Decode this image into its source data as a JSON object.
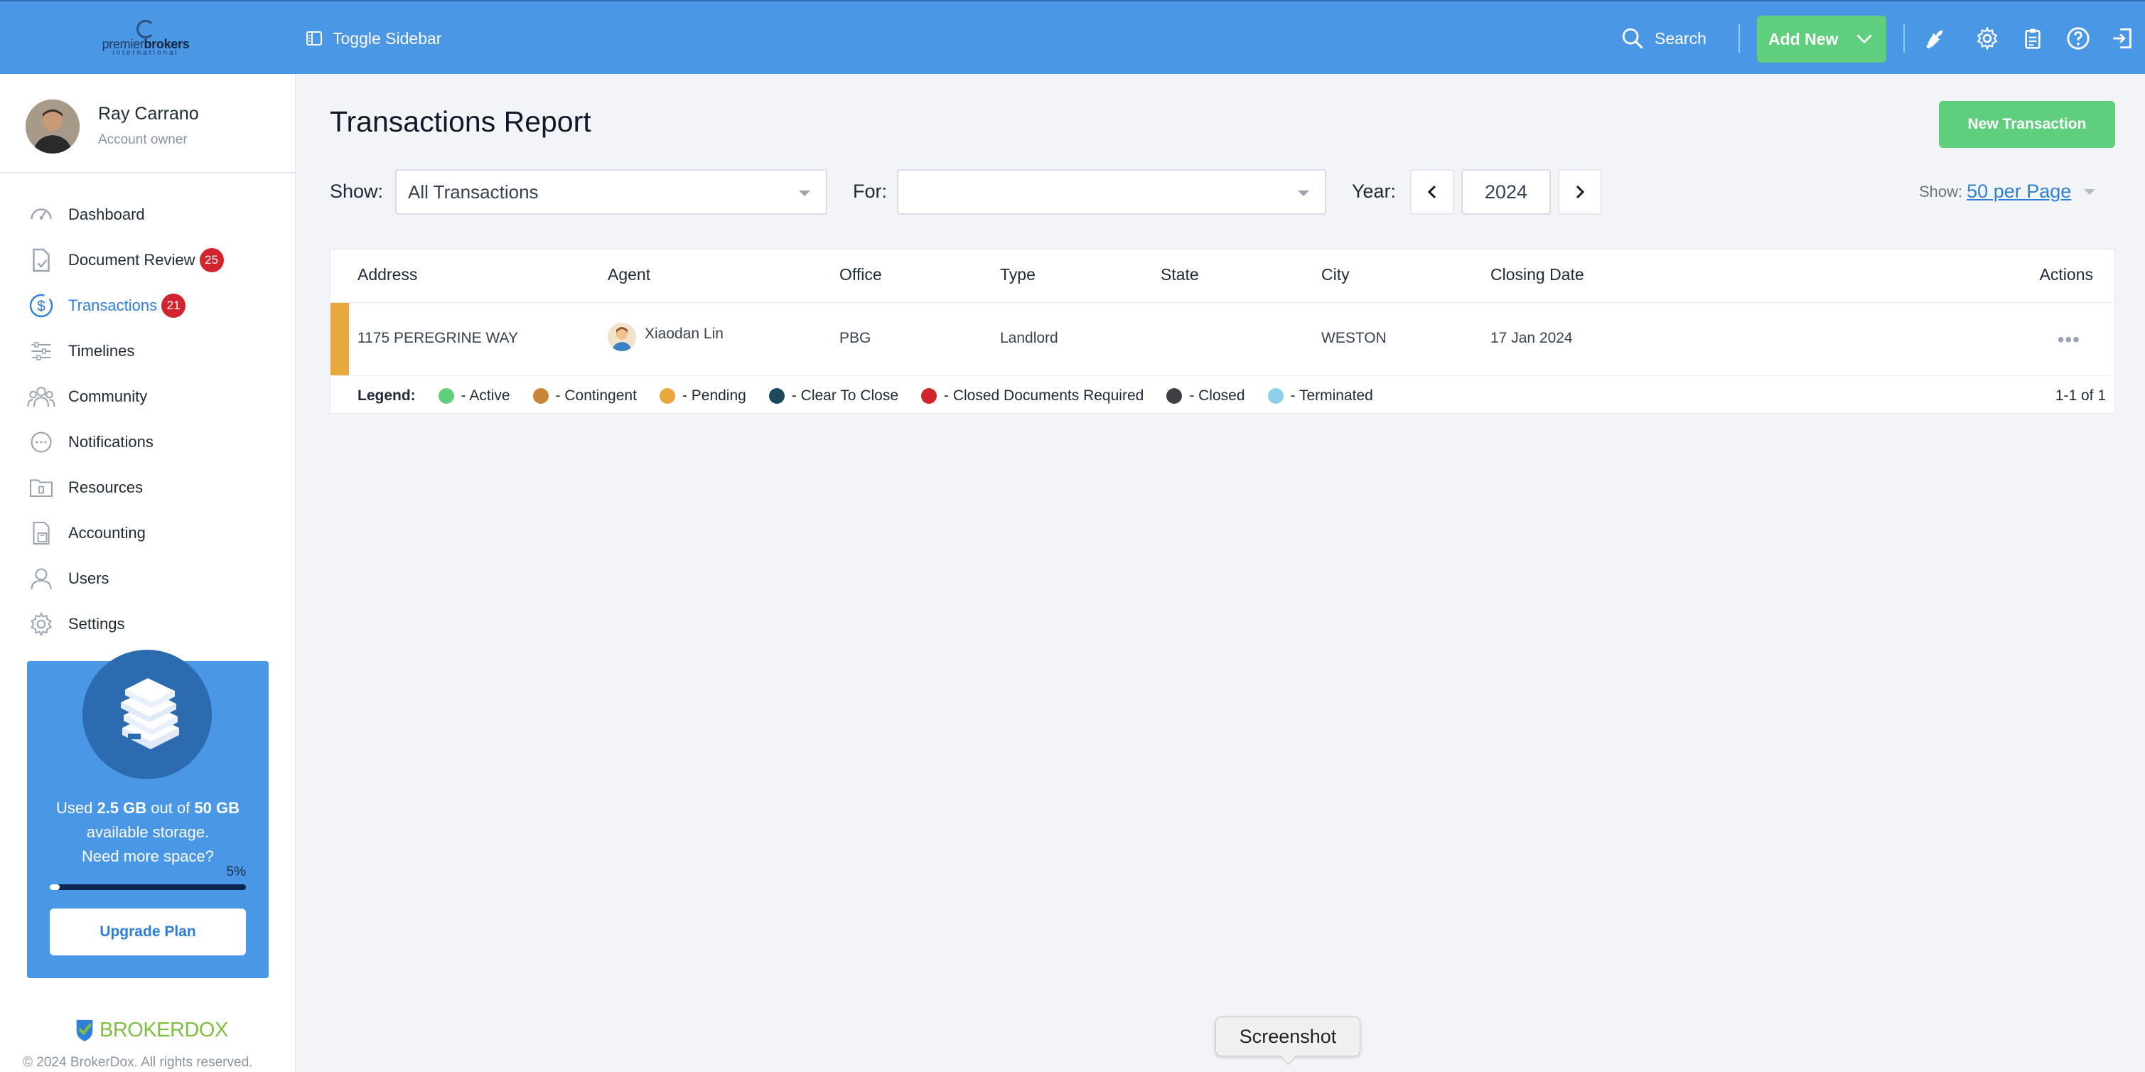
{
  "topbar": {
    "logo": {
      "text_light": "premier",
      "text_bold": "brokers",
      "sub": "international"
    },
    "toggle_label": "Toggle Sidebar",
    "search_label": "Search",
    "add_new_label": "Add New",
    "icons": [
      "bell-icon",
      "gear-icon",
      "clipboard-icon",
      "help-icon",
      "logout-icon"
    ]
  },
  "user": {
    "name": "Ray Carrano",
    "role": "Account owner"
  },
  "nav": [
    {
      "label": "Dashboard",
      "icon": "gauge-icon"
    },
    {
      "label": "Document Review",
      "icon": "document-check-icon",
      "badge": "25"
    },
    {
      "label": "Transactions",
      "icon": "dollar-circle-icon",
      "badge": "21",
      "active": true
    },
    {
      "label": "Timelines",
      "icon": "sliders-icon"
    },
    {
      "label": "Community",
      "icon": "people-icon"
    },
    {
      "label": "Notifications",
      "icon": "chat-bubble-icon"
    },
    {
      "label": "Resources",
      "icon": "folder-icon"
    },
    {
      "label": "Accounting",
      "icon": "calculator-icon"
    },
    {
      "label": "Users",
      "icon": "user-icon"
    },
    {
      "label": "Settings",
      "icon": "gear-icon"
    }
  ],
  "storage": {
    "used": "2.5 GB",
    "total": "50 GB",
    "line1_prefix": "Used ",
    "line1_mid": " out of ",
    "line2": "available storage.",
    "line3": "Need more space?",
    "percent_label": "5%",
    "percent": 5,
    "upgrade_label": "Upgrade Plan"
  },
  "footer": {
    "brand_a": "BROKER",
    "brand_b": "DOX",
    "copyright": "© 2024 BrokerDox. All rights reserved."
  },
  "main": {
    "title": "Transactions Report",
    "new_button": "New Transaction",
    "filters": {
      "show_label": "Show:",
      "show_value": "All Transactions",
      "for_label": "For:",
      "for_value": "",
      "year_label": "Year:",
      "year_value": "2024",
      "per_page_label": "Show:",
      "per_page_value": "50 per Page"
    },
    "columns": [
      "Address",
      "Agent",
      "Office",
      "Type",
      "State",
      "City",
      "Closing Date",
      "Actions"
    ],
    "rows": [
      {
        "status_color": "#e8a83c",
        "address": "1175 PEREGRINE WAY",
        "agent": "Xiaodan Lin",
        "office": "PBG",
        "type": "Landlord",
        "state": "",
        "city": "WESTON",
        "closing_date": "17 Jan 2024",
        "actions": "•••"
      }
    ],
    "legend_title": "Legend:",
    "legend": [
      {
        "label": "- Active",
        "color": "#5fcf7d"
      },
      {
        "label": "- Contingent",
        "color": "#c98438"
      },
      {
        "label": "- Pending",
        "color": "#e8a83c"
      },
      {
        "label": "- Clear To Close",
        "color": "#1d4a5a"
      },
      {
        "label": "- Closed Documents Required",
        "color": "#d1242f"
      },
      {
        "label": "- Closed",
        "color": "#3f3f46"
      },
      {
        "label": "- Terminated",
        "color": "#8ecfe8"
      }
    ],
    "pagination": "1-1 of 1"
  },
  "tooltip": "Screenshot",
  "colors": {
    "topbar": "#4a97e6",
    "accent": "#2e7fd9",
    "green": "#5fcf7d",
    "badge": "#d1242f"
  }
}
